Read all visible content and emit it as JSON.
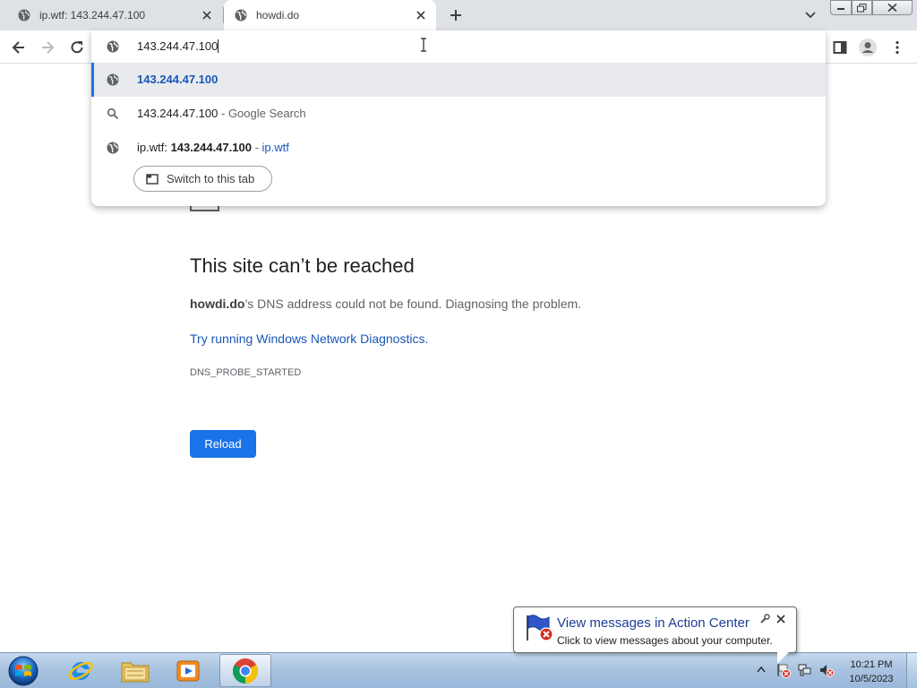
{
  "browser": {
    "tabs": [
      {
        "title": "ip.wtf: 143.244.47.100",
        "favicon": "globe-icon",
        "active": false
      },
      {
        "title": "howdi.do",
        "favicon": "globe-icon",
        "active": true
      }
    ],
    "omnibox": {
      "input_value": "143.244.47.100",
      "suggestions": [
        {
          "icon": "globe-icon",
          "text": "143.244.47.100"
        },
        {
          "icon": "search-icon",
          "text": "143.244.47.100",
          "separator": " - ",
          "suffix": "Google Search"
        },
        {
          "icon": "globe-icon",
          "prefix": "ip.wtf: ",
          "match": "143.244.47.100",
          "separator": " - ",
          "suffix": "ip.wtf"
        }
      ],
      "switch_tab_label": "Switch to this tab"
    }
  },
  "error_page": {
    "title": "This site can’t be reached",
    "host": "howdi.do",
    "message": "’s DNS address could not be found. Diagnosing the problem.",
    "link": "Try running Windows Network Diagnostics",
    "link_period": ".",
    "code": "DNS_PROBE_STARTED",
    "reload_label": "Reload"
  },
  "notification": {
    "title": "View messages in Action Center",
    "text": "Click to view messages about your computer."
  },
  "taskbar": {
    "apps": [
      "internet-explorer",
      "windows-explorer",
      "media-player",
      "chrome"
    ],
    "clock_time": "10:21 PM",
    "clock_date": "10/5/2023"
  },
  "colors": {
    "accent_blue": "#1a73e8",
    "link_blue": "#1a56b8",
    "tabstrip": "#dee1e6"
  }
}
